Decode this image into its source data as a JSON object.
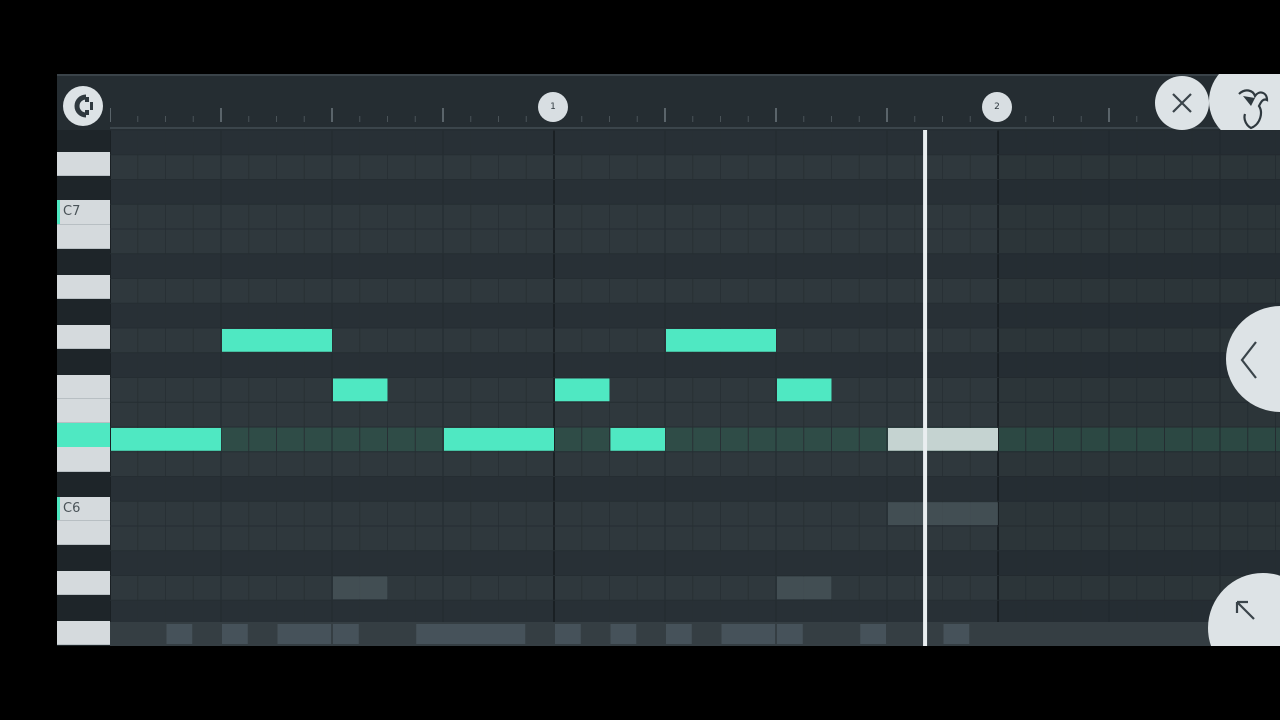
{
  "ruler": {
    "bar_markers": [
      "1",
      "2"
    ]
  },
  "keys": [
    {
      "label": "C7"
    },
    {
      "label": "C6"
    }
  ],
  "colors": {
    "note": "#4fe8c2",
    "selected_note": "#c5d3d1",
    "background": "#2b3338",
    "button": "#dde3e6"
  },
  "icons": {
    "magnet": "magnet-snap-icon",
    "close": "close-icon",
    "logo": "fruit-logo-icon",
    "prev": "chevron-left-icon",
    "expand": "arrow-up-left-icon"
  }
}
